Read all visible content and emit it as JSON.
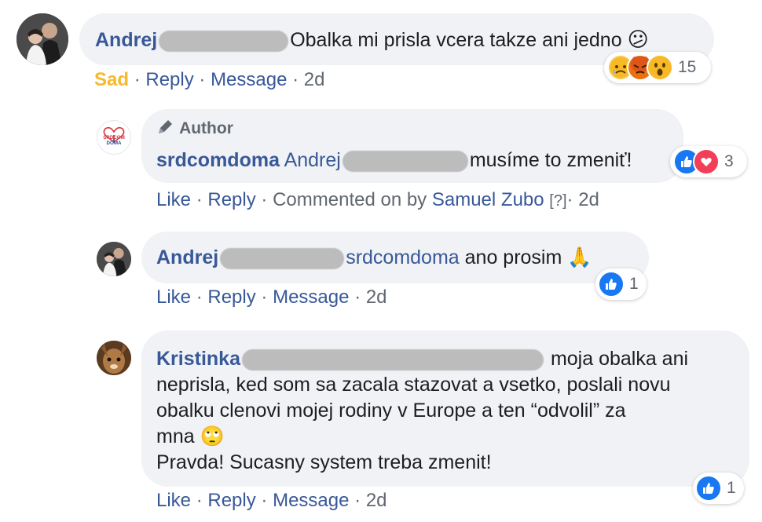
{
  "comments": [
    {
      "name": "Andrej",
      "text": "Obalka mi prisla vcera takze ani jedno",
      "emoji": "😕",
      "reaction_count": "15",
      "actions": {
        "reaction": "Sad",
        "reply": "Reply",
        "message": "Message",
        "time": "2d"
      }
    },
    {
      "author_badge": "Author",
      "name": "srdcomdoma",
      "mention": "Andrej",
      "text": "musíme to zmeniť!",
      "reaction_count": "3",
      "actions": {
        "like": "Like",
        "reply": "Reply",
        "commented_on_by": "Commented on by",
        "commenter": "Samuel Zubo",
        "help": "[?]",
        "time": "2d"
      }
    },
    {
      "name": "Andrej",
      "mention": "srdcomdoma",
      "text": "ano prosim",
      "emoji": "🙏",
      "reaction_count": "1",
      "actions": {
        "like": "Like",
        "reply": "Reply",
        "message": "Message",
        "time": "2d"
      }
    },
    {
      "name": "Kristinka",
      "text_line1": "moja obalka ani",
      "text_line2": "neprisla, ked som sa zacala stazovat a vsetko, poslali novu",
      "text_line3": "obalku clenovi mojej rodiny v Europe a ten “odvolil” za",
      "text_line4": "mna",
      "emoji": "🙄",
      "text_line5": "Pravda! Sucasny system treba zmenit!",
      "reaction_count": "1",
      "actions": {
        "like": "Like",
        "reply": "Reply",
        "message": "Message",
        "time": "2d"
      }
    }
  ],
  "page_logo_text": [
    "SRDCOM",
    "DOMA"
  ],
  "separator": "·",
  "colors": {
    "link": "#385898",
    "sad": "#f7b928",
    "like": "#1877f2",
    "love": "#f33e58",
    "bubble": "#f0f2f5"
  }
}
